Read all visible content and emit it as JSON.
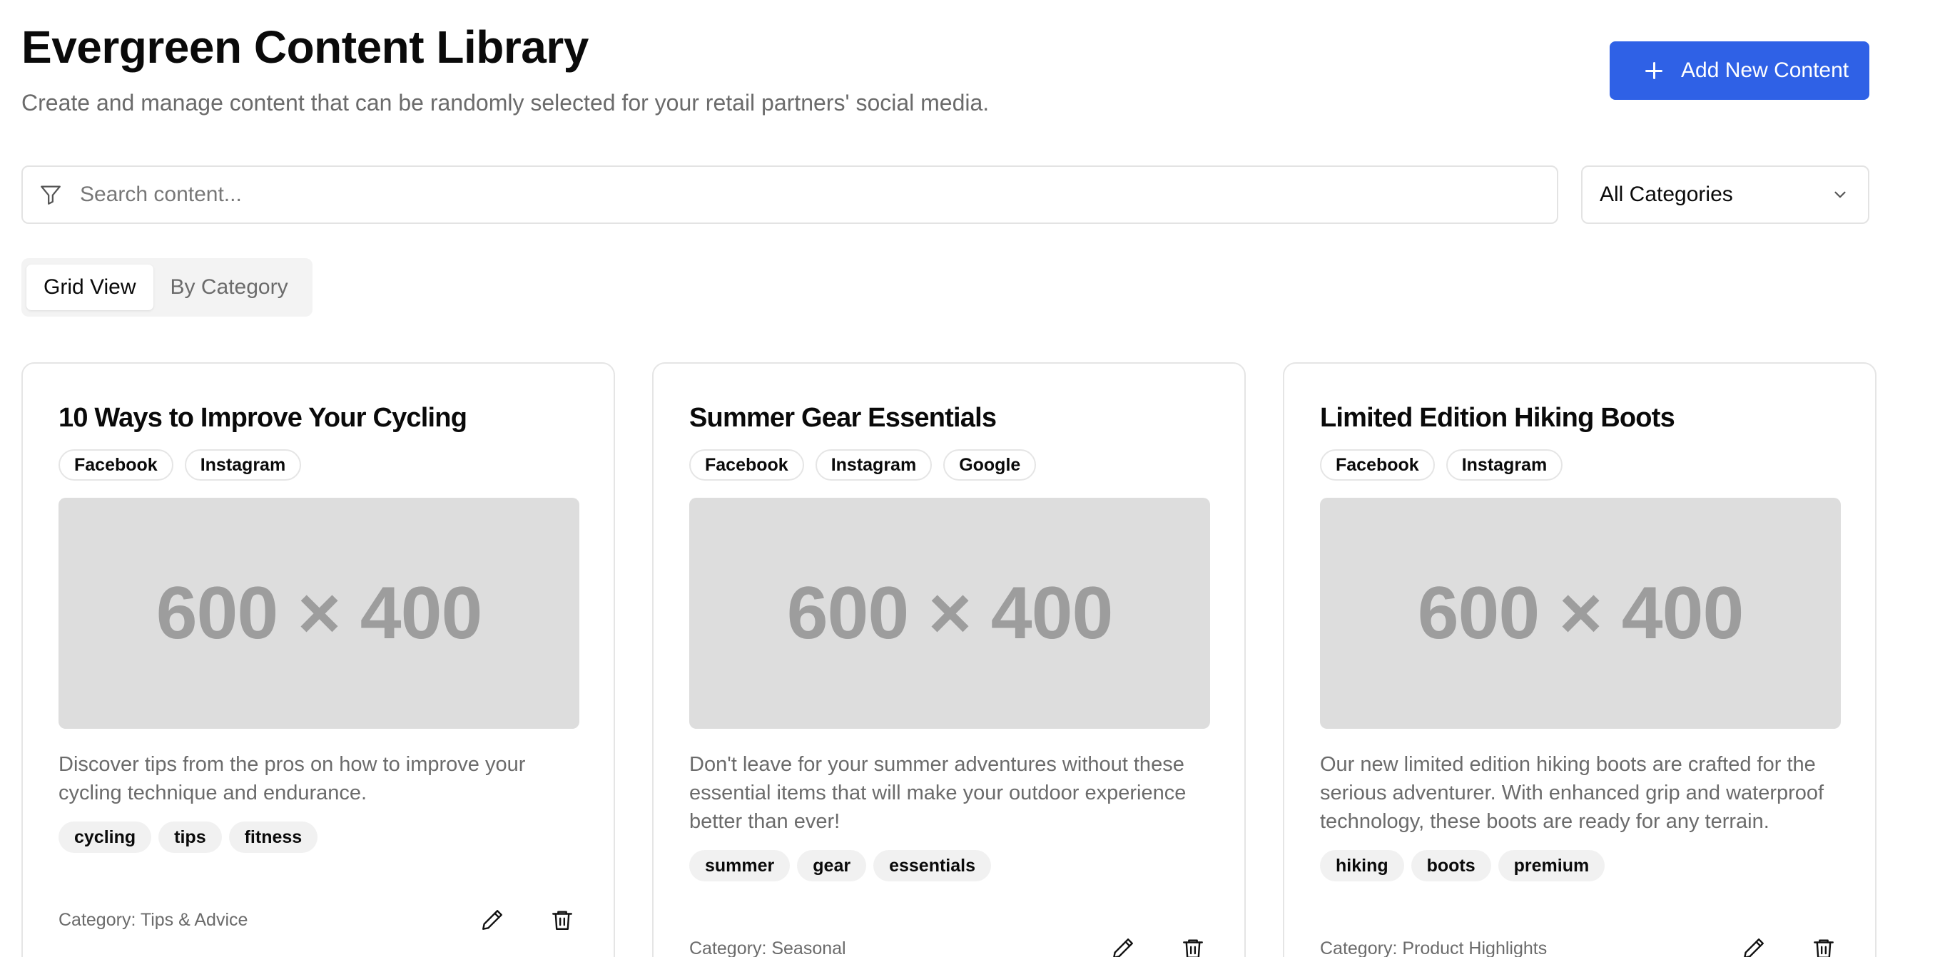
{
  "header": {
    "title": "Evergreen Content Library",
    "subtitle": "Create and manage content that can be randomly selected for your retail partners' social media.",
    "add_button_label": "Add New Content"
  },
  "search": {
    "placeholder": "Search content...",
    "value": ""
  },
  "category_filter": {
    "selected": "All Categories"
  },
  "view_tabs": [
    {
      "label": "Grid View",
      "active": true
    },
    {
      "label": "By Category",
      "active": false
    }
  ],
  "cards": [
    {
      "title": "10 Ways to Improve Your Cycling",
      "platforms": [
        "Facebook",
        "Instagram"
      ],
      "image_placeholder": "600 × 400",
      "description": "Discover tips from the pros on how to improve your cycling technique and endurance.",
      "tags": [
        "cycling",
        "tips",
        "fitness"
      ],
      "category": "Category: Tips & Advice"
    },
    {
      "title": "Summer Gear Essentials",
      "platforms": [
        "Facebook",
        "Instagram",
        "Google"
      ],
      "image_placeholder": "600 × 400",
      "description": "Don't leave for your summer adventures without these essential items that will make your outdoor experience better than ever!",
      "tags": [
        "summer",
        "gear",
        "essentials"
      ],
      "category": "Category: Seasonal"
    },
    {
      "title": "Limited Edition Hiking Boots",
      "platforms": [
        "Facebook",
        "Instagram"
      ],
      "image_placeholder": "600 × 400",
      "description": "Our new limited edition hiking boots are crafted for the serious adventurer. With enhanced grip and waterproof technology, these boots are ready for any terrain.",
      "tags": [
        "hiking",
        "boots",
        "premium"
      ],
      "category": "Category: Product Highlights"
    }
  ],
  "icons": {
    "add": "plus-icon",
    "search": "filter-icon",
    "select": "chevron-down-icon",
    "edit": "pencil-icon",
    "delete": "trash-icon"
  },
  "colors": {
    "accent": "#2f61e6",
    "muted_text": "#6b6b6b",
    "border": "#e5e5e5",
    "image_placeholder_bg": "#dddddd",
    "tag_bg": "#f1f1f1"
  }
}
